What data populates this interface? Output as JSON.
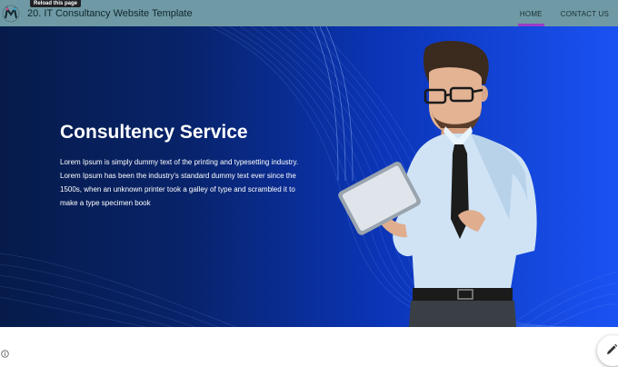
{
  "tooltip": "Reload this page",
  "header": {
    "title": "20. IT Consultancy Website Template",
    "nav": [
      {
        "label": "HOME",
        "active": true
      },
      {
        "label": "CONTACT US",
        "active": false
      }
    ]
  },
  "hero": {
    "title": "Consultency Service",
    "text": "Lorem Ipsum is simply dummy text of the printing and typesetting industry. Lorem Ipsum has been the industry's standard dummy text ever since the 1500s, when an unknown printer took a galley of type and scrambled it to make a type specimen book"
  },
  "colors": {
    "topbar": "#6f9aa5",
    "active_indicator": "#9b3cc8",
    "hero_dark": "#061b4a",
    "hero_bright": "#1a52f2"
  },
  "icons": {
    "logo": "logo-icon",
    "info": "info-icon",
    "edit": "pencil-icon"
  }
}
